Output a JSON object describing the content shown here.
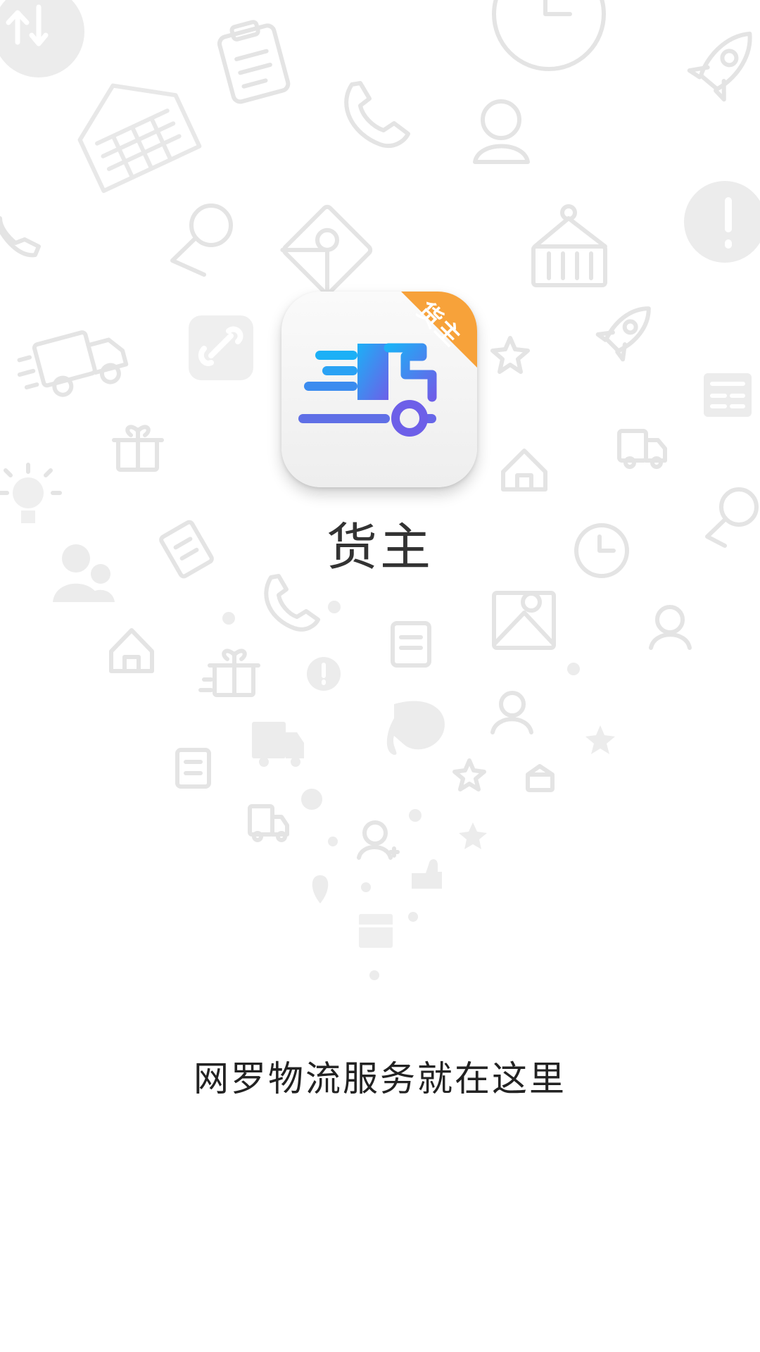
{
  "app": {
    "name": "货主",
    "badge": "货主",
    "slogan": "网罗物流服务就在这里"
  },
  "colors": {
    "background": "#ffffff",
    "badge": "#f7a23a",
    "truck_gradient_start": "#1cb0f6",
    "truck_gradient_end": "#6d5fe8",
    "decor_icons": "#e6e6e6"
  },
  "icons": {
    "truck": "truck-icon",
    "decor": [
      "transfer-icon",
      "clipboard-icon",
      "clock-icon",
      "rocket-icon",
      "warehouse-icon",
      "phone-icon",
      "user-icon",
      "alert-icon",
      "location-icon",
      "map-icon",
      "container-icon",
      "link-icon",
      "star-icon",
      "delivery-truck-icon",
      "news-icon",
      "gift-icon",
      "home-icon",
      "lightbulb-icon",
      "receipt-icon",
      "people-icon",
      "thumbs-up-icon",
      "store-icon",
      "user-add-icon",
      "pin-icon"
    ]
  }
}
